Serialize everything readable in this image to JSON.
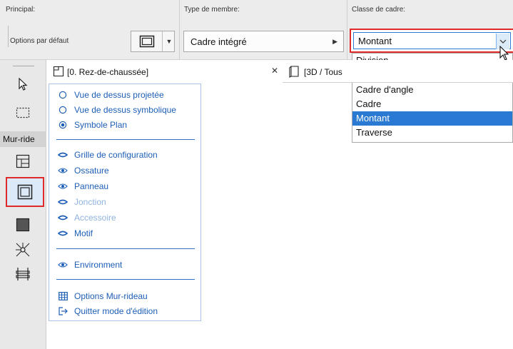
{
  "infobar": {
    "principal_label": "Principal:",
    "options_label": "Options par défaut",
    "member_type_label": "Type de membre:",
    "member_type_value": "Cadre intégré",
    "frame_class_label": "Classe de cadre:"
  },
  "frame_class_combo": {
    "value": "Montant",
    "options": [
      {
        "label": "Division",
        "selected": false
      },
      {
        "label": "Cadre d'angle",
        "selected": false
      },
      {
        "label": "Cadre",
        "selected": false
      },
      {
        "label": "Montant",
        "selected": true
      },
      {
        "label": "Traverse",
        "selected": false
      }
    ]
  },
  "toolbox": {
    "label": "Mur-ride",
    "tools": [
      "arrow-tool",
      "marquee-tool",
      "grid-tool",
      "frame-tool",
      "panel-tool",
      "junction-tool",
      "accessory-tool"
    ]
  },
  "tabs": [
    {
      "label": "[0. Rez-de-chaussée]",
      "active": true
    },
    {
      "label": "[3D / Tous",
      "active": false
    }
  ],
  "palette": {
    "views": [
      {
        "label": "Vue de dessus projetée",
        "selected": false
      },
      {
        "label": "Vue de dessus symbolique",
        "selected": false
      },
      {
        "label": "Symbole Plan",
        "selected": true
      }
    ],
    "components": [
      {
        "label": "Grille de configuration",
        "dim": false
      },
      {
        "label": "Ossature",
        "dim": false
      },
      {
        "label": "Panneau",
        "dim": false
      },
      {
        "label": "Jonction",
        "dim": true
      },
      {
        "label": "Accessoire",
        "dim": true
      },
      {
        "label": "Motif",
        "dim": false
      }
    ],
    "environment": "Environment",
    "actions": [
      {
        "label": "Options Mur-rideau"
      },
      {
        "label": "Quitter mode d'édition"
      }
    ]
  },
  "colors": {
    "accent_blue": "#1d5eb6",
    "selection_blue": "#2a79d2",
    "highlight_red": "#e02a2a"
  }
}
